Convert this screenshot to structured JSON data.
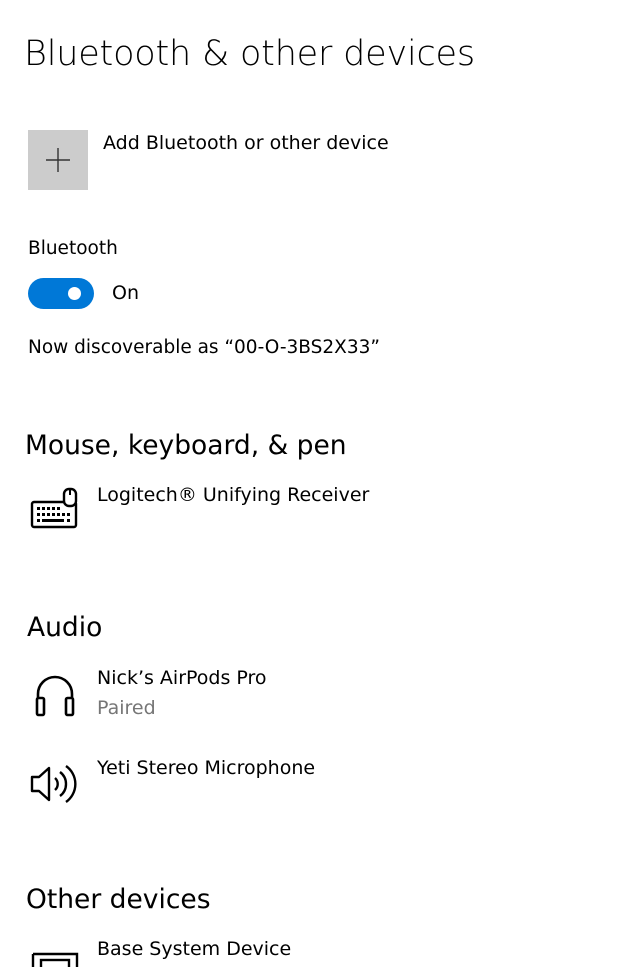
{
  "page": {
    "title": "Bluetooth & other devices"
  },
  "add_device": {
    "label": "Add Bluetooth or other device",
    "icon": "plus-icon"
  },
  "bluetooth": {
    "label": "Bluetooth",
    "toggle_state": "On",
    "enabled": true,
    "discoverable_text": "Now discoverable as “00-O-3BS2X33”",
    "accent_color": "#0078d7"
  },
  "sections": {
    "mouse_keyboard_pen": {
      "heading": "Mouse, keyboard, & pen",
      "devices": [
        {
          "name": "Logitech® Unifying Receiver",
          "icon": "keyboard-icon"
        }
      ]
    },
    "audio": {
      "heading": "Audio",
      "devices": [
        {
          "name": "Nick’s AirPods Pro",
          "status": "Paired",
          "icon": "headphones-icon"
        },
        {
          "name": "Yeti Stereo Microphone",
          "icon": "speaker-icon"
        }
      ]
    },
    "other_devices": {
      "heading": "Other devices",
      "devices": [
        {
          "name": "Base System Device",
          "icon": "device-icon"
        }
      ]
    }
  }
}
